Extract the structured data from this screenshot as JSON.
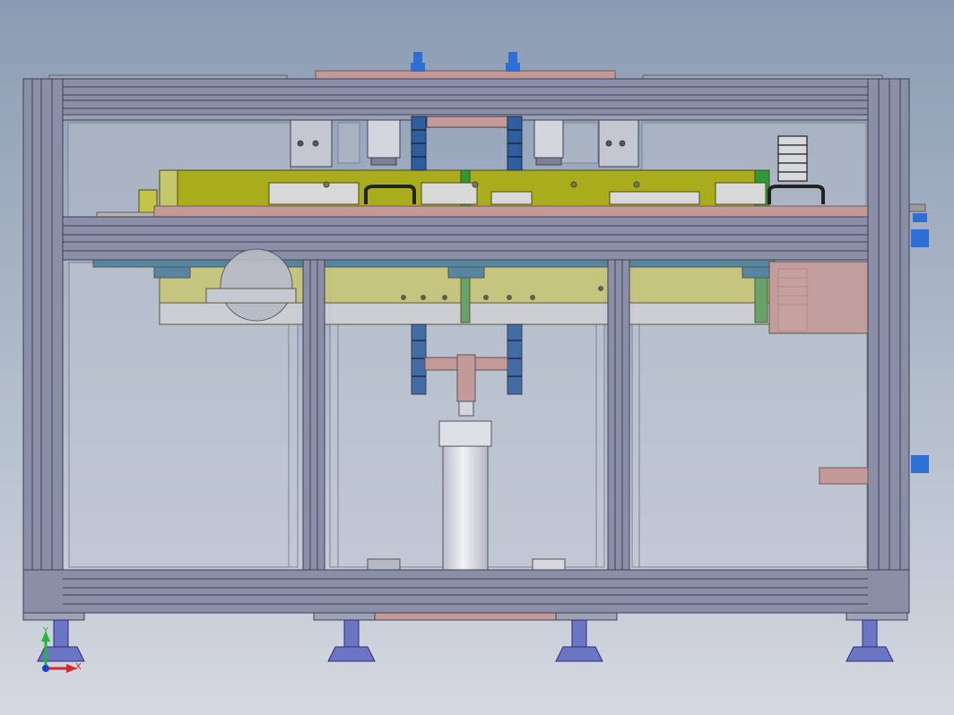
{
  "background": {
    "top": "#8a9cb3",
    "bottom": "#d4d8e0"
  },
  "colors": {
    "frame_profile": "#8a8ea6",
    "frame_dark": "#4b4e66",
    "panel_fill": "#c7ccd6",
    "yellow_plate": "#a9ad1c",
    "yellow_light": "#c7c678",
    "green_strip": "#2d9a3a",
    "pink_part": "#c49a98",
    "blue_chain": "#2f5e9e",
    "blue_fitting": "#2e6fd6",
    "foot": "#6c74c4",
    "cylinder": "#dcdfe6"
  },
  "axis_triad": {
    "y_label": "Y",
    "x_label": "X"
  }
}
